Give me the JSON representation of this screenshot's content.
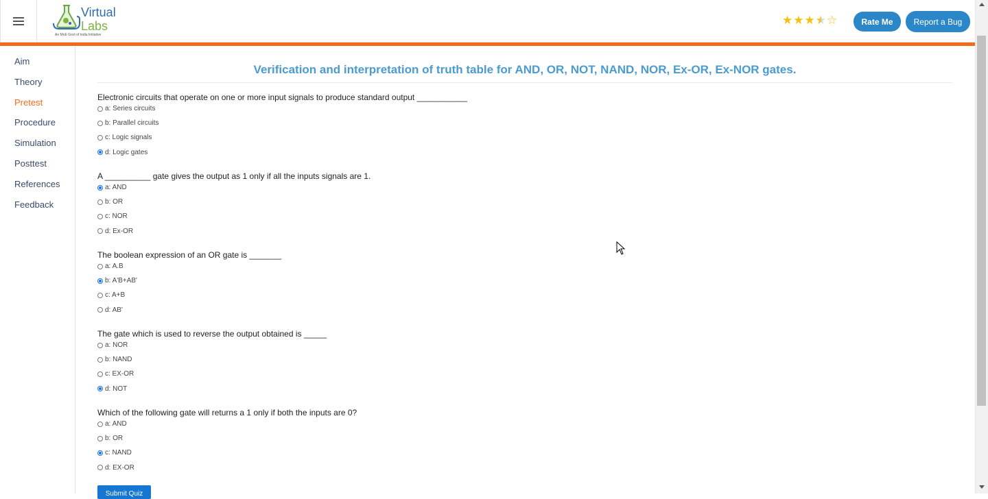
{
  "header": {
    "logo_line1": "Virtual",
    "logo_line2": "Labs",
    "logo_tagline": "An MoE Govt of India Initiative",
    "rating": 3.5,
    "rate_button": "Rate Me",
    "bug_button": "Report a Bug",
    "accent_color": "#f26b1d",
    "button_color": "#2b87c8"
  },
  "sidebar": {
    "items": [
      {
        "label": "Aim"
      },
      {
        "label": "Theory"
      },
      {
        "label": "Pretest"
      },
      {
        "label": "Procedure"
      },
      {
        "label": "Simulation"
      },
      {
        "label": "Posttest"
      },
      {
        "label": "References"
      },
      {
        "label": "Feedback"
      }
    ],
    "active": "Pretest"
  },
  "main": {
    "title": "Verification and interpretation of truth table for AND, OR, NOT, NAND, NOR, Ex-OR, Ex-NOR gates.",
    "questions": [
      {
        "text": "Electronic circuits that operate on one or more input signals to produce standard output ___________",
        "options": [
          "a: Series circuits",
          "b: Parallel circuits",
          "c: Logic signals",
          "d: Logic gates"
        ],
        "selected": 3
      },
      {
        "text": "A __________ gate gives the output as 1 only if all the inputs signals are 1.",
        "options": [
          "a: AND",
          "b: OR",
          "c: NOR",
          "d: Ex-OR"
        ],
        "selected": 0
      },
      {
        "text": "The boolean expression of an OR gate is _______",
        "options": [
          "a: A.B",
          "b: A'B+AB'",
          "c: A+B",
          "d: AB'"
        ],
        "selected": 1
      },
      {
        "text": "The gate which is used to reverse the output obtained is _____",
        "options": [
          "a: NOR",
          "b: NAND",
          "c: EX-OR",
          "d: NOT"
        ],
        "selected": 3
      },
      {
        "text": "Which of the following gate will returns a 1 only if both the inputs are 0?",
        "options": [
          "a: AND",
          "b: OR",
          "c: NAND",
          "d: EX-OR"
        ],
        "selected": 2
      }
    ],
    "submit_label": "Submit Quiz"
  }
}
